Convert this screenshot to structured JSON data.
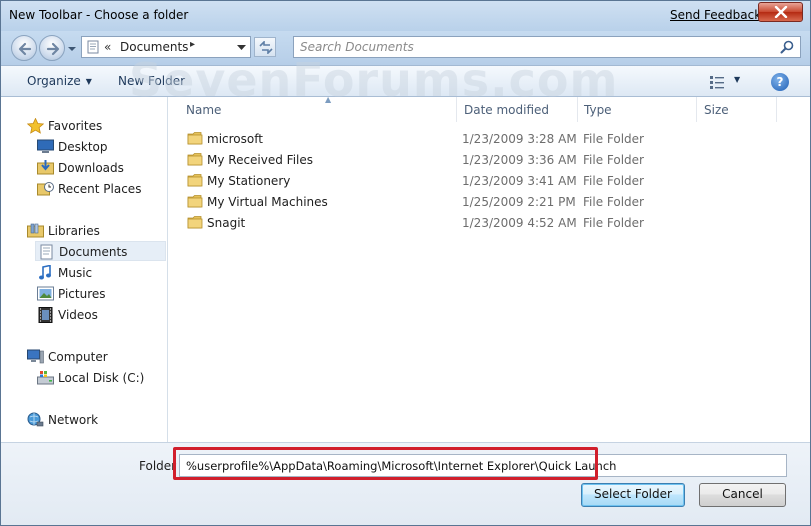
{
  "window": {
    "title": "New Toolbar - Choose a folder",
    "feedback_link": "Send Feedback"
  },
  "address_bar": {
    "chevron": "«",
    "crumb": "Documents",
    "crumb_arrow": "▸"
  },
  "search": {
    "placeholder": "Search Documents"
  },
  "toolbar": {
    "organize": "Organize",
    "new_folder": "New Folder",
    "help": "?"
  },
  "watermark": "SevenForums.com",
  "sidebar": {
    "items": [
      {
        "label": "Favorites",
        "icon": "star-icon"
      },
      {
        "label": "Desktop",
        "icon": "desktop-icon"
      },
      {
        "label": "Downloads",
        "icon": "downloads-icon"
      },
      {
        "label": "Recent Places",
        "icon": "recent-places-icon"
      },
      {
        "label": "Libraries",
        "icon": "libraries-icon"
      },
      {
        "label": "Documents",
        "icon": "documents-icon",
        "selected": true
      },
      {
        "label": "Music",
        "icon": "music-icon"
      },
      {
        "label": "Pictures",
        "icon": "pictures-icon"
      },
      {
        "label": "Videos",
        "icon": "videos-icon"
      },
      {
        "label": "Computer",
        "icon": "computer-icon"
      },
      {
        "label": "Local Disk (C:)",
        "icon": "local-disk-icon"
      },
      {
        "label": "Network",
        "icon": "network-icon"
      }
    ]
  },
  "columns": [
    "Name",
    "Date modified",
    "Type",
    "Size"
  ],
  "files": [
    {
      "name": "microsoft",
      "date": "1/23/2009 3:28 AM",
      "type": "File Folder"
    },
    {
      "name": "My Received Files",
      "date": "1/23/2009 3:36 AM",
      "type": "File Folder"
    },
    {
      "name": "My Stationery",
      "date": "1/23/2009 3:41 AM",
      "type": "File Folder"
    },
    {
      "name": "My Virtual Machines",
      "date": "1/25/2009 2:21 PM",
      "type": "File Folder"
    },
    {
      "name": "Snagit",
      "date": "1/23/2009 4:52 AM",
      "type": "File Folder"
    }
  ],
  "bottom": {
    "folder_label": "Folder",
    "folder_value": "%userprofile%\\AppData\\Roaming\\Microsoft\\Internet Explorer\\Quick Launch",
    "select_button": "Select Folder",
    "cancel_button": "Cancel"
  },
  "colors": {
    "highlight_border": "#d11f2c",
    "frame": "#bcd3ea",
    "toolbar_text": "#1e395b"
  }
}
